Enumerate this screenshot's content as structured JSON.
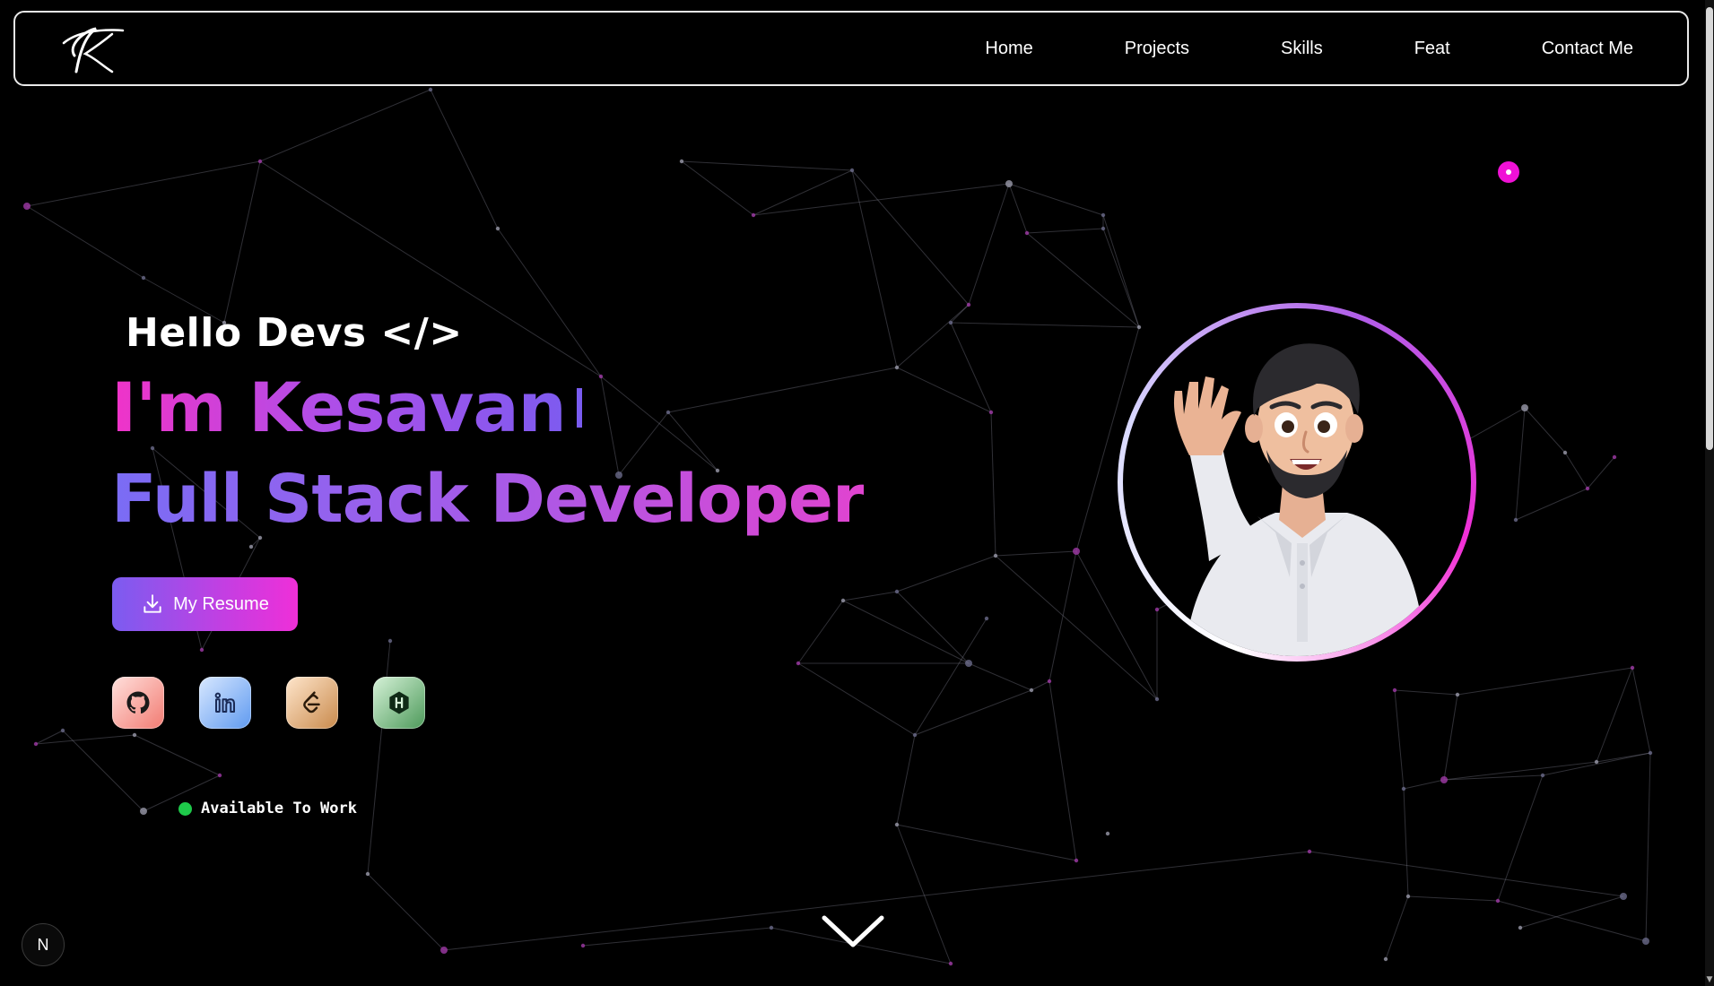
{
  "nav": {
    "logo_icon": "k-signature-logo-icon",
    "links": [
      "Home",
      "Projects",
      "Skills",
      "Feat",
      "Contact Me"
    ]
  },
  "hero": {
    "greeting": "Hello Devs </>",
    "name": "I'm Kesavan",
    "role": "Full Stack Developer",
    "resume_button": "My Resume",
    "resume_icon": "download-icon",
    "status_text": "Available To Work",
    "status_color": "#1ec94a"
  },
  "socials": [
    {
      "name": "github-icon"
    },
    {
      "name": "linkedin-icon"
    },
    {
      "name": "leetcode-icon"
    },
    {
      "name": "hackerrank-icon"
    }
  ],
  "misc": {
    "scroll_icon": "chevron-down-icon",
    "corner_badge": "N"
  },
  "colors": {
    "accent_pink": "#f011d6",
    "accent_purple": "#7a5cf0",
    "background": "#000000"
  }
}
